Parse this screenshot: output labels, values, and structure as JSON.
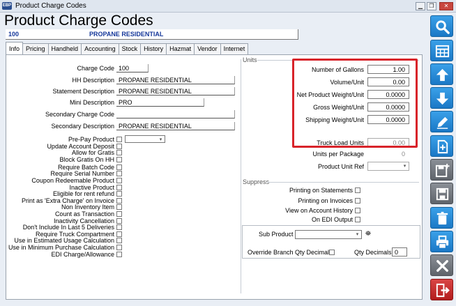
{
  "window": {
    "title": "Product Charge Codes",
    "app_icon_text": "EBP"
  },
  "page": {
    "title": "Product Charge Codes",
    "code": "100",
    "description": "PROPANE RESIDENTIAL"
  },
  "tabs": [
    "Info",
    "Pricing",
    "Handheld",
    "Accounting",
    "Stock",
    "History",
    "Hazmat",
    "Vendor",
    "Internet"
  ],
  "left": {
    "charge_code": {
      "label": "Charge Code",
      "value": "100"
    },
    "hh_description": {
      "label": "HH Description",
      "value": "PROPANE RESIDENTIAL"
    },
    "statement_description": {
      "label": "Statement Description",
      "value": "PROPANE RESIDENTIAL"
    },
    "mini_description": {
      "label": "Mini Description",
      "value": "PRO"
    },
    "secondary_charge_code": {
      "label": "Secondary Charge Code",
      "value": ""
    },
    "secondary_description": {
      "label": "Secondary Description",
      "value": "PROPANE RESIDENTIAL"
    },
    "checkboxes": [
      "Pre-Pay Product",
      "Update Account Deposit",
      "Allow for Gratis",
      "Block Gratis On HH",
      "Require Batch Code",
      "Require Serial Number",
      "Coupon Redeemable Product",
      "Inactive Product",
      "Eligible for rent refund",
      "Print as 'Extra Charge' on Invoice",
      "Non Inventory Item",
      "Count as Transaction",
      "Inactivity Cancellation",
      "Don't Include In Last 5 Deliveries",
      "Require Truck Compartment",
      "Use in Estimated Usage Calculation",
      "Use in Minimum Purchase Calculation",
      "EDI Charge/Allowance"
    ]
  },
  "units": {
    "section_title": "Units",
    "number_of_gallons": {
      "label": "Number of Gallons",
      "value": "1.00"
    },
    "volume_unit": {
      "label": "Volume/Unit",
      "value": "0.00"
    },
    "net_product_weight_unit": {
      "label": "Net Product Weight/Unit",
      "value": "0.0000"
    },
    "gross_weight_unit": {
      "label": "Gross Weight/Unit",
      "value": "0.0000"
    },
    "shipping_weight_unit": {
      "label": "Shipping Weight/Unit",
      "value": "0.0000"
    },
    "truck_load_units": {
      "label": "Truck Load Units",
      "value": "0.00"
    },
    "units_per_package": {
      "label": "Units per Package",
      "value": "0"
    },
    "product_unit_ref": {
      "label": "Product Unit Ref",
      "value": ""
    }
  },
  "suppress": {
    "section_title": "Suppress",
    "items": [
      "Printing on Statements",
      "Printing on Invoices",
      "View on Account History",
      "On EDI Output"
    ]
  },
  "bottom": {
    "sub_product": {
      "label": "Sub Product",
      "value": ""
    },
    "override_branch_qty_decimals": {
      "label": "Override Branch Qty Decimals"
    },
    "qty_decimals": {
      "label": "Qty Decimals",
      "value": "0"
    }
  },
  "sidebar": [
    "search-icon",
    "grid-icon",
    "arrow-up-icon",
    "arrow-down-icon",
    "edit-icon",
    "new-document-icon",
    "save-new-icon",
    "save-icon",
    "trash-icon",
    "print-icon",
    "cancel-icon",
    "exit-icon"
  ],
  "colors": {
    "accent": "#1a78c6",
    "highlight": "#d8232a",
    "header_text": "#15379a",
    "exit": "#b31d1d"
  }
}
